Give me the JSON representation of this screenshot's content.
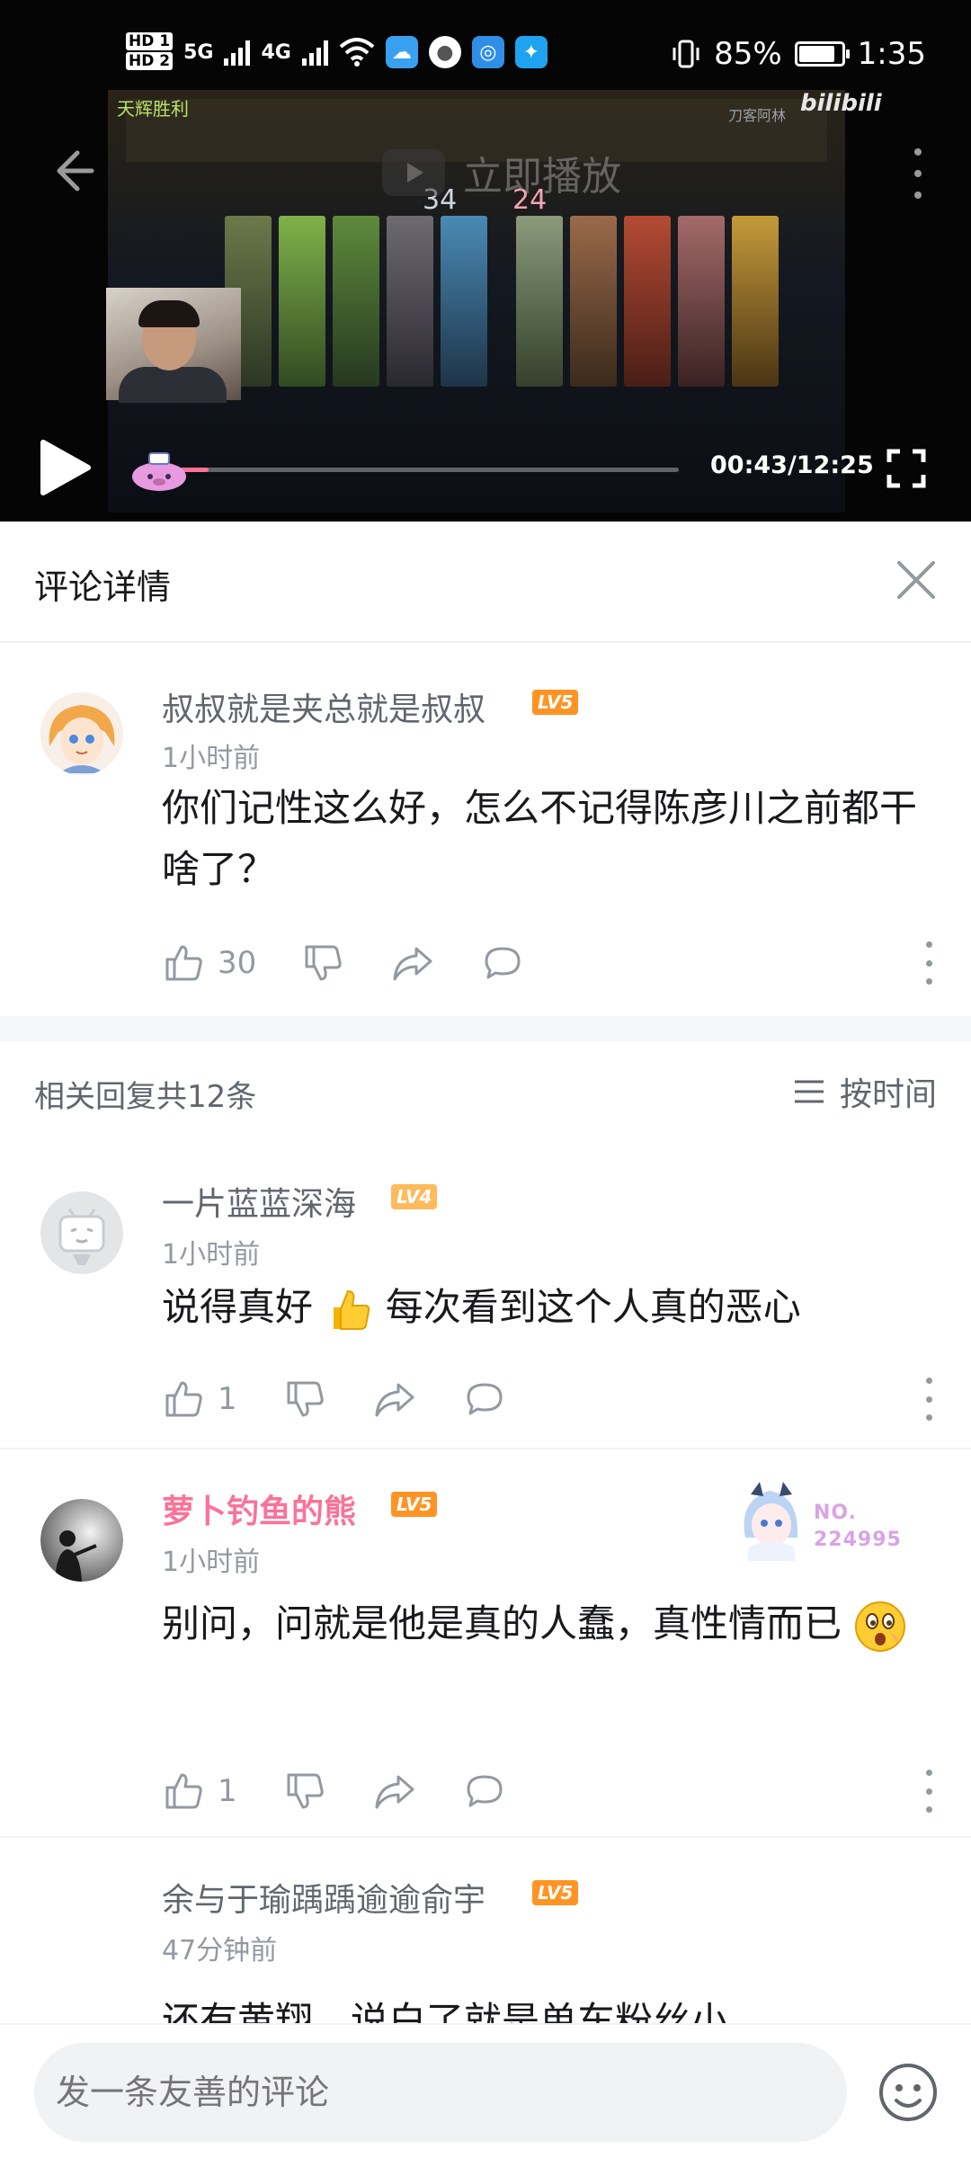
{
  "status_bar": {
    "battery": "85%",
    "time": "1:35",
    "hd1": "HD 1",
    "hd2": "HD 2",
    "net1": "5G",
    "net2": "4G"
  },
  "video": {
    "play_now_label": "立即播放",
    "time_display": "00:43/12:25",
    "progress_fraction": 0.058,
    "overlay_victory": "天辉胜利",
    "overlay_score_left": "34",
    "overlay_score_right": "24",
    "overlay_watermark": "刀客阿林",
    "overlay_brand": "bilibili"
  },
  "detail": {
    "title": "评论详情"
  },
  "root_comment": {
    "username": "叔叔就是夹总就是叔叔",
    "level": "LV5",
    "time": "1小时前",
    "text": "你们记性这么好，怎么不记得陈彦川之前都干啥了？",
    "likes": "30"
  },
  "replies_header": {
    "count_label": "相关回复共12条",
    "sort_label": "按时间"
  },
  "replies": [
    {
      "username": "一片蓝蓝深海",
      "level": "LV4",
      "time": "1小时前",
      "text_part1": "说得真好",
      "text_part2": "每次看到这个人真的恶心",
      "likes": "1"
    },
    {
      "username": "萝卜钓鱼的熊",
      "level": "LV5",
      "time": "1小时前",
      "text": "别问，问就是他是真的人蠢，真性情而已",
      "likes": "1",
      "fan_badge_no": "NO.",
      "fan_badge_number": "224995"
    },
    {
      "username": "余与于瑜踽踽逾逾俞宇",
      "level": "LV5",
      "time": "47分钟前",
      "text": "还有黄翔，说白了就是单车粉丝小"
    }
  ],
  "input": {
    "placeholder": "发一条友善的评论"
  },
  "colors": {
    "accent_pink": "#fb7299",
    "level_orange": "#ff9425",
    "text_secondary": "#9499a0"
  },
  "icons": {
    "like": "thumbs-up-icon",
    "dislike": "thumbs-down-icon",
    "share": "share-icon",
    "reply": "comment-bubble-icon",
    "more": "more-vertical-icon",
    "close": "close-icon",
    "sort": "sort-lines-icon",
    "emoji": "emoji-face-icon"
  }
}
